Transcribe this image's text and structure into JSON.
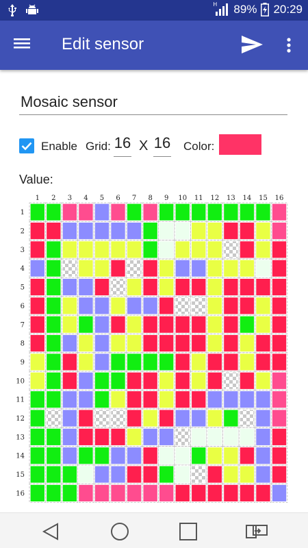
{
  "status": {
    "battery_text": "89%",
    "time": "20:29",
    "network_letter": "H",
    "icons": [
      "usb-icon",
      "android-debug-icon",
      "signal-icon",
      "battery-icon"
    ]
  },
  "app_bar": {
    "title": "Edit sensor",
    "icons": [
      "menu-icon",
      "send-icon",
      "overflow-menu-icon"
    ]
  },
  "form": {
    "name": "Mosaic sensor",
    "enable_checked": true,
    "enable_label": "Enable",
    "grid_label": "Grid:",
    "grid_cols": "16",
    "x_label": "X",
    "grid_rows": "16",
    "color_label": "Color:",
    "color_value": "#ff3366",
    "value_label": "Value:"
  },
  "colors": {
    "R": "#ff1f4e",
    "P": "#ff4c8f",
    "G": "#11ee11",
    "Y": "#e9ff44",
    "B": "#8c8cff",
    "W": "#ecffee",
    "C": "checker"
  },
  "mosaic": {
    "cols": [
      "1",
      "2",
      "3",
      "4",
      "5",
      "6",
      "7",
      "8",
      "9",
      "10",
      "11",
      "12",
      "13",
      "14",
      "15",
      "16"
    ],
    "rows": [
      "1",
      "2",
      "3",
      "4",
      "5",
      "6",
      "7",
      "8",
      "9",
      "10",
      "11",
      "12",
      "13",
      "14",
      "15",
      "16"
    ],
    "cells": [
      "GGPPBPGPGGGGGGGP",
      "RRBBBBBGWWYYRRYP",
      "RGYYYYYGWYYYCRYR",
      "BGCYYRCRYBBYYYWR",
      "RGBBRCYRYRRYRRRR",
      "RGYBBYBBRCCYRRYR",
      "RGYGBRYRRRRYRGYR",
      "RGBYBYYRRRRYRYRR",
      "YGRYBGGGGRYRRYRR",
      "YGRBGGRRYRYRCRYP",
      "GGBBGYRRYRRBBBBP",
      "GCBRCCRYRBBYGCBP",
      "GGBRRRYBBCWWWWBR",
      "GGBGGBBRWWGYYRBR",
      "GGGWBBRRGWCRYYBR",
      "GGGPPPPPPRRRRRRB"
    ]
  },
  "nav": {
    "icons": [
      "back-icon",
      "home-icon",
      "recents-icon",
      "rotate-screen-icon"
    ]
  }
}
